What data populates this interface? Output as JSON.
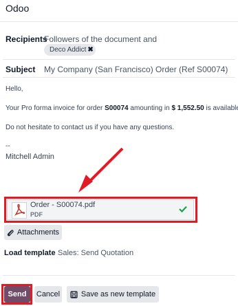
{
  "app": {
    "title": "Odoo"
  },
  "recipients": {
    "label": "Recipients",
    "value": "Followers of the document and",
    "tag": "Deco Addict",
    "tag_remove": "✖"
  },
  "subject": {
    "label": "Subject",
    "value": "My Company (San Francisco) Order (Ref S00074)"
  },
  "message": {
    "greeting": "Hello,",
    "line1_pre": "Your Pro forma invoice for order ",
    "order_ref": "S00074",
    "line1_mid": " amounting in ",
    "amount": "$ 1,552.50",
    "line1_post": " is available.",
    "line2": "Do not hesitate to contact us if you have any questions.",
    "separator": "--",
    "signature": "Mitchell Admin"
  },
  "attachment": {
    "name": "Order - S00074.pdf",
    "type": "PDF"
  },
  "buttons": {
    "attachments": "Attachments",
    "send": "Send",
    "cancel": "Cancel",
    "save_template": "Save as new template"
  },
  "template": {
    "label": "Load template",
    "value": "Sales: Send Quotation"
  },
  "colors": {
    "primary": "#714b67",
    "highlight": "#e01b24",
    "success": "#16a34a",
    "pdf_red": "#c0392b"
  },
  "icons": {
    "attach": "paperclip-icon",
    "pdf": "pdf-file-icon",
    "check": "check-icon",
    "save": "floppy-disk-icon"
  }
}
